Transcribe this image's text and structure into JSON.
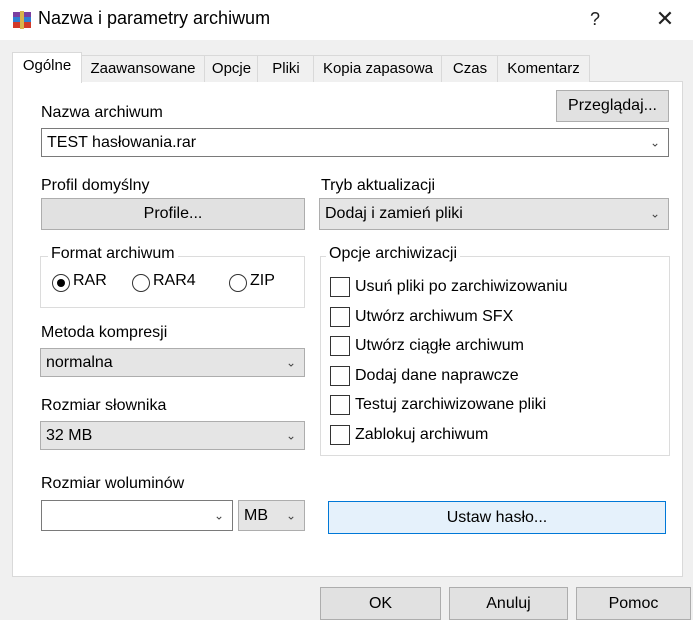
{
  "window": {
    "title": "Nazwa i parametry archiwum",
    "help_glyph": "?",
    "close_glyph": "✕"
  },
  "tabs": [
    {
      "label": "Ogólne",
      "active": true
    },
    {
      "label": "Zaawansowane",
      "active": false
    },
    {
      "label": "Opcje",
      "active": false
    },
    {
      "label": "Pliki",
      "active": false
    },
    {
      "label": "Kopia zapasowa",
      "active": false
    },
    {
      "label": "Czas",
      "active": false
    },
    {
      "label": "Komentarz",
      "active": false
    }
  ],
  "archive_name": {
    "label": "Nazwa archiwum",
    "browse_label": "Przeglądaj...",
    "value": "TEST hasłowania.rar"
  },
  "profile": {
    "label": "Profil domyślny",
    "button_label": "Profile..."
  },
  "update_mode": {
    "label": "Tryb aktualizacji",
    "value": "Dodaj i zamień pliki"
  },
  "archive_format": {
    "title": "Format archiwum",
    "options": [
      {
        "label": "RAR",
        "selected": true
      },
      {
        "label": "RAR4",
        "selected": false
      },
      {
        "label": "ZIP",
        "selected": false
      }
    ]
  },
  "archive_options": {
    "title": "Opcje archiwizacji",
    "items": [
      {
        "label": "Usuń pliki po zarchiwizowaniu",
        "checked": false
      },
      {
        "label": "Utwórz archiwum SFX",
        "checked": false
      },
      {
        "label": "Utwórz ciągłe archiwum",
        "checked": false
      },
      {
        "label": "Dodaj dane naprawcze",
        "checked": false
      },
      {
        "label": "Testuj zarchiwizowane pliki",
        "checked": false
      },
      {
        "label": "Zablokuj archiwum",
        "checked": false
      }
    ]
  },
  "compression": {
    "label": "Metoda kompresji",
    "value": "normalna"
  },
  "dictionary": {
    "label": "Rozmiar słownika",
    "value": "32 MB"
  },
  "volumes": {
    "label": "Rozmiar woluminów",
    "value": "",
    "unit": "MB"
  },
  "set_password_label": "Ustaw hasło...",
  "footer": {
    "ok_label": "OK",
    "cancel_label": "Anuluj",
    "help_label": "Pomoc"
  }
}
